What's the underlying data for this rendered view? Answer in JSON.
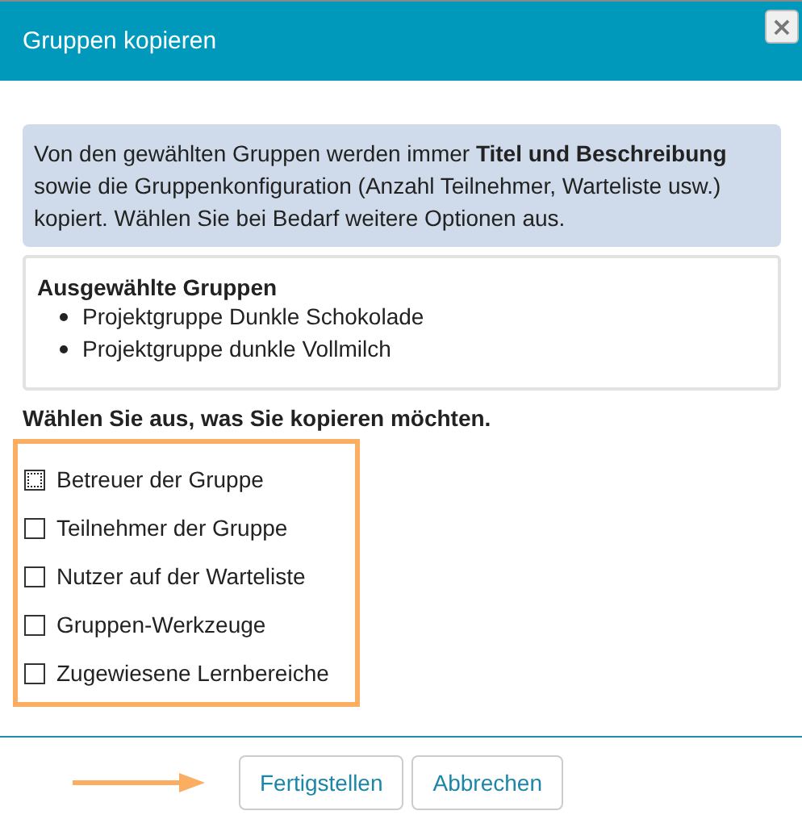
{
  "dialog": {
    "title": "Gruppen kopieren",
    "close": "×"
  },
  "info": "Von den gewählten Gruppen werden immer **Titel und Beschreibung** sowie die Gruppenkonfiguration (Anzahl Teilnehmer, Warteliste usw.) kopiert. Wählen Sie bei Bedarf weitere Optionen aus.",
  "selected_groups": {
    "heading": "Ausgewählte Gruppen",
    "items": [
      "Projektgruppe Dunkle Schokolade",
      "Projektgruppe dunkle Vollmilch"
    ]
  },
  "options_heading": "Wählen Sie aus, was Sie kopieren möchten.",
  "options": [
    {
      "label": "Betreuer der Gruppe",
      "checked": false,
      "focused": true
    },
    {
      "label": "Teilnehmer der Gruppe",
      "checked": false,
      "focused": false
    },
    {
      "label": "Nutzer auf der Warteliste",
      "checked": false,
      "focused": false
    },
    {
      "label": "Gruppen-Werkzeuge",
      "checked": false,
      "focused": false
    },
    {
      "label": "Zugewiesene Lernbereiche",
      "checked": false,
      "focused": false
    }
  ],
  "buttons": [
    "Fertigstellen",
    "Abbrechen"
  ]
}
